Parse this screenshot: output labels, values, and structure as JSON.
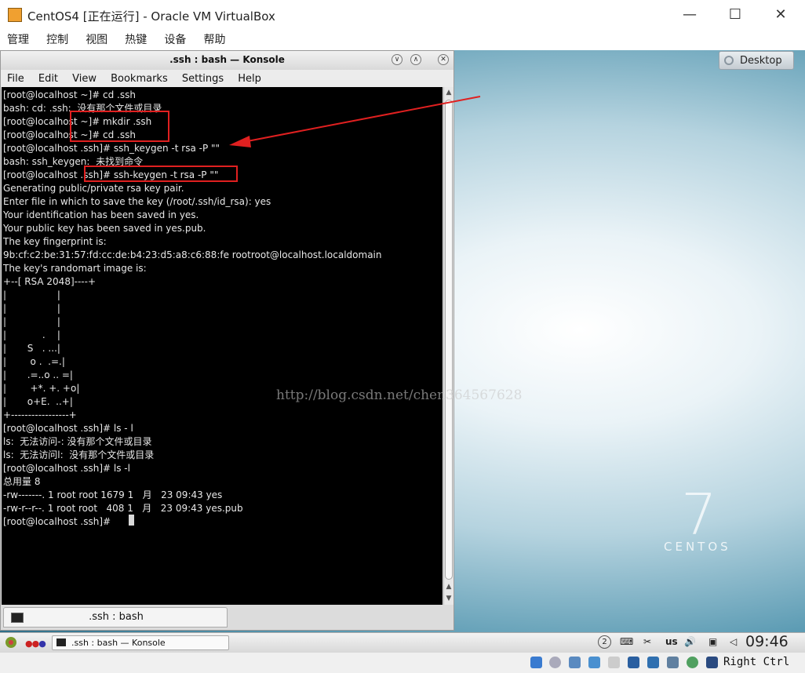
{
  "host": {
    "title": "CentOS4 [正在运行] - Oracle VM VirtualBox",
    "menu": [
      "管理",
      "控制",
      "视图",
      "热键",
      "设备",
      "帮助"
    ],
    "controls": {
      "minimize": "—",
      "maximize": "☐",
      "close": "✕"
    }
  },
  "guest": {
    "desktop_button": "Desktop",
    "brand_number": "7",
    "brand_text": "CENTOS",
    "konsole": {
      "title": ".ssh : bash — Konsole",
      "menu": [
        "File",
        "Edit",
        "View",
        "Bookmarks",
        "Settings",
        "Help"
      ],
      "lines": [
        "[root@localhost ~]# cd .ssh",
        "bash: cd: .ssh:  没有那个文件或目录",
        "[root@localhost ~]# mkdir .ssh",
        "[root@localhost ~]# cd .ssh",
        "[root@localhost .ssh]# ssh_keygen -t rsa -P \"\"",
        "bash: ssh_keygen:  未找到命令",
        "[root@localhost .ssh]# ssh-keygen -t rsa -P \"\"",
        "Generating public/private rsa key pair.",
        "Enter file in which to save the key (/root/.ssh/id_rsa): yes",
        "Your identification has been saved in yes.",
        "Your public key has been saved in yes.pub.",
        "The key fingerprint is:",
        "9b:cf:c2:be:31:57:fd:cc:de:b4:23:d5:a8:c6:88:fe rootroot@localhost.localdomain",
        "The key's randomart image is:",
        "+--[ RSA 2048]----+",
        "|                 |",
        "|                 |",
        "|                 |",
        "|            .    |",
        "|       S   . ...|",
        "|        o .  .=.|",
        "|       .=..o .. =|",
        "|        +*. +. +o|",
        "|       o+E.  ..+|",
        "+-----------------+",
        "[root@localhost .ssh]# ls - l",
        "ls:  无法访问-: 没有那个文件或目录",
        "ls:  无法访问l:  没有那个文件或目录",
        "[root@localhost .ssh]# ls -l",
        "总用量 8",
        "-rw-------. 1 root root 1679 1   月   23 09:43 yes",
        "-rw-r--r--. 1 root root   408 1   月   23 09:43 yes.pub",
        "[root@localhost .ssh]# "
      ],
      "tab_label": ".ssh : bash"
    },
    "watermark": "http://blog.csdn.net/chen364567628",
    "taskbar": {
      "task_label": ".ssh : bash — Konsole",
      "desktop_number": "2",
      "keyboard_layout": "us",
      "clock": "09:46"
    }
  },
  "statusbar": {
    "host_key": "Right Ctrl"
  },
  "colors": {
    "annotation_red": "#e02020",
    "terminal_bg": "#000000",
    "terminal_fg": "#e8e8e8"
  }
}
